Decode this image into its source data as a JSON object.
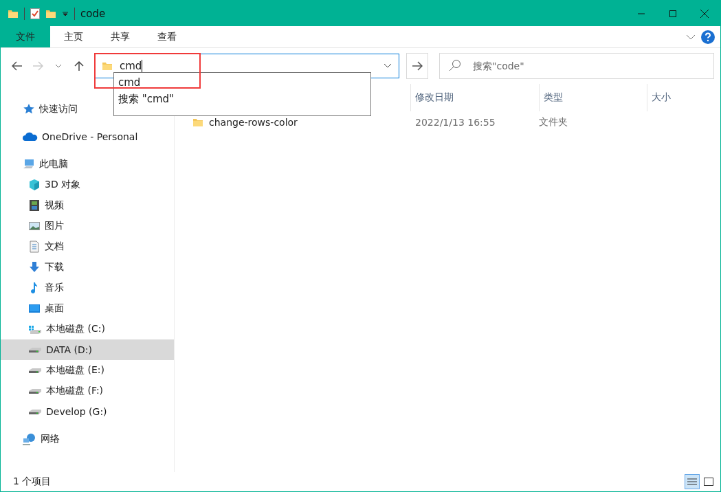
{
  "window": {
    "title": "code"
  },
  "ribbon_tabs": [
    {
      "label": "文件",
      "kind": "file"
    },
    {
      "label": "主页",
      "kind": "tab"
    },
    {
      "label": "共享",
      "kind": "tab"
    },
    {
      "label": "查看",
      "kind": "tab"
    }
  ],
  "address_bar": {
    "value": "cmd",
    "highlighted": true,
    "suggestions": [
      "cmd",
      "搜索 \"cmd\""
    ]
  },
  "search": {
    "placeholder": "搜索\"code\""
  },
  "sidebar": {
    "items": [
      {
        "label": "快速访问",
        "selected": false
      },
      {
        "label": "OneDrive - Personal",
        "selected": false
      },
      {
        "label": "此电脑",
        "selected": false,
        "children": [
          {
            "label": "3D 对象",
            "selected": false
          },
          {
            "label": "视频",
            "selected": false
          },
          {
            "label": "图片",
            "selected": false
          },
          {
            "label": "文档",
            "selected": false
          },
          {
            "label": "下载",
            "selected": false
          },
          {
            "label": "音乐",
            "selected": false
          },
          {
            "label": "桌面",
            "selected": false
          },
          {
            "label": "本地磁盘 (C:)",
            "selected": false
          },
          {
            "label": "DATA (D:)",
            "selected": true
          },
          {
            "label": "本地磁盘 (E:)",
            "selected": false
          },
          {
            "label": "本地磁盘 (F:)",
            "selected": false
          },
          {
            "label": "Develop (G:)",
            "selected": false
          }
        ]
      },
      {
        "label": "网络",
        "selected": false
      }
    ]
  },
  "table": {
    "columns": [
      "修改日期",
      "类型",
      "大小"
    ],
    "rows": [
      {
        "name": "change-rows-color",
        "modified": "2022/1/13 16:55",
        "type": "文件夹"
      }
    ]
  },
  "status_bar": {
    "count": "1 个项目"
  }
}
